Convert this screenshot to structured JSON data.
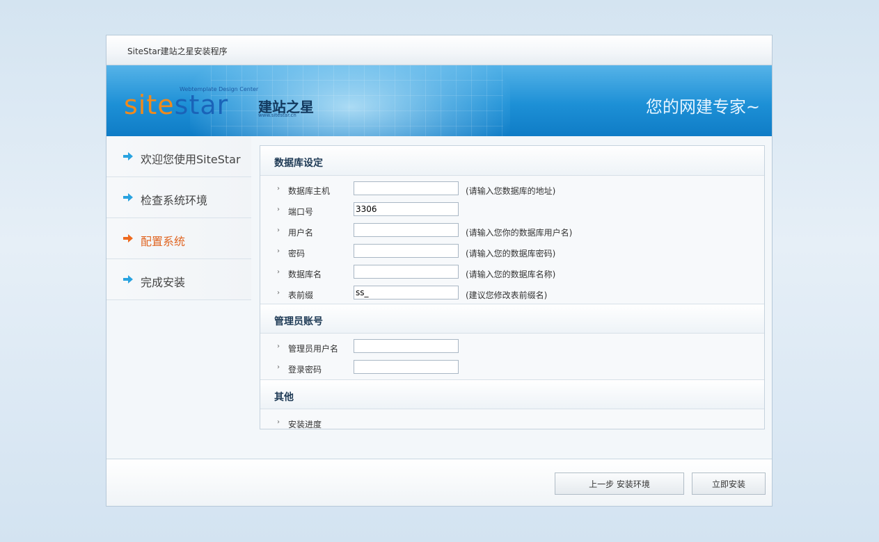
{
  "window": {
    "title": "SiteStar建站之星安装程序"
  },
  "banner": {
    "logo_part1": "site",
    "logo_part2": "star",
    "logo_tagline": "Webtemplate Design Center",
    "logo_cn": "建站之星",
    "logo_url": "www.sitestar.cn",
    "slogan": "您的网建专家~"
  },
  "sidebar": {
    "items": [
      {
        "label": "欢迎您使用SiteStar"
      },
      {
        "label": "检查系统环境"
      },
      {
        "label": "配置系统"
      },
      {
        "label": "完成安装"
      }
    ],
    "active_index": 2
  },
  "db_section": {
    "title": "数据库设定",
    "fields": [
      {
        "label": "数据库主机",
        "value": "",
        "hint": "(请输入您数据库的地址)"
      },
      {
        "label": "端口号",
        "value": "3306",
        "hint": ""
      },
      {
        "label": "用户名",
        "value": "",
        "hint": "(请输入您你的数据库用户名)"
      },
      {
        "label": "密码",
        "value": "",
        "hint": "(请输入您的数据库密码)"
      },
      {
        "label": "数据库名",
        "value": "",
        "hint": "(请输入您的数据库名称)"
      },
      {
        "label": "表前缀",
        "value": "ss_",
        "hint": "(建议您修改表前缀名)"
      }
    ]
  },
  "admin_section": {
    "title": "管理员账号",
    "fields": [
      {
        "label": "管理员用户名",
        "value": ""
      },
      {
        "label": "登录密码",
        "value": ""
      }
    ]
  },
  "other_section": {
    "title": "其他",
    "fields": [
      {
        "label": "安装进度"
      }
    ]
  },
  "footer": {
    "prev_label": "上一步 安装环境",
    "install_label": "立即安装"
  },
  "colors": {
    "active": "#e06522",
    "arrow_blue": "#29a3e0",
    "arrow_orange": "#ee6a1f"
  }
}
